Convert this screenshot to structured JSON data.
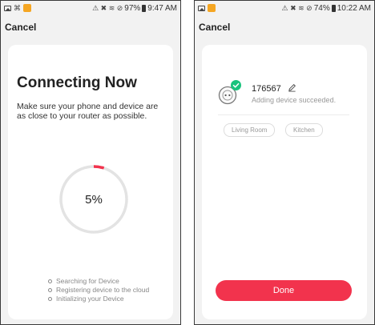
{
  "colors": {
    "accent": "#f2334d",
    "progress_track": "#e3e3e3",
    "success_check": "#19c37d",
    "notification_icon": "#f5a623"
  },
  "screens": [
    {
      "status_bar": {
        "left_icons": [
          "picture-icon",
          "cast-icon",
          "notification-icon"
        ],
        "indicators": "⚠ ✖ ≋ ⊘",
        "battery": "97%",
        "time": "9:47 AM"
      },
      "cancel_label": "Cancel",
      "title": "Connecting Now",
      "description": "Make sure your phone and device are as close to your router as possible.",
      "progress": {
        "percent": 5,
        "label": "5%"
      },
      "steps": [
        "Searching for Device",
        "Registering device to the cloud",
        "Initializing your Device"
      ]
    },
    {
      "status_bar": {
        "left_icons": [
          "picture-icon",
          "notification-icon"
        ],
        "indicators": "⚠ ✖ ≋ ⊘",
        "battery": "74%",
        "time": "10:22 AM"
      },
      "cancel_label": "Cancel",
      "device": {
        "name": "176567",
        "status": "Adding device succeeded.",
        "icon": "smart-plug-icon"
      },
      "rooms": [
        "Living Room",
        "Kitchen"
      ],
      "done_label": "Done"
    }
  ]
}
